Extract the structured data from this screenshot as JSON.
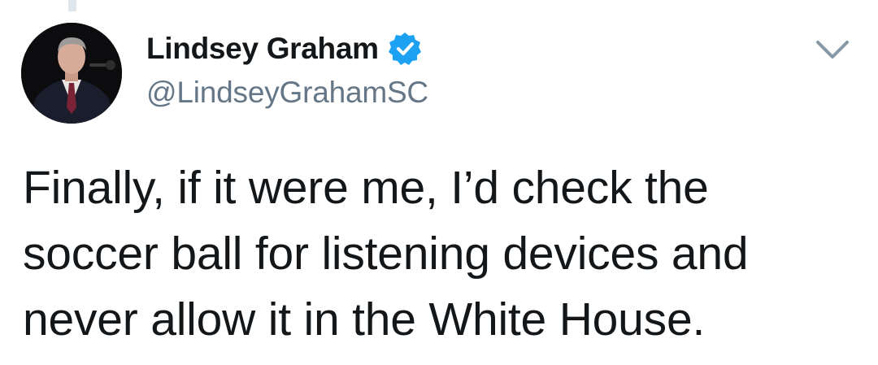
{
  "tweet": {
    "author": {
      "display_name": "Lindsey Graham",
      "handle": "@LindseyGrahamSC",
      "verified": true,
      "avatar_icon": "profile-photo"
    },
    "text_lines": [
      "Finally, if it were me, I’d check the",
      "soccer ball for listening devices and",
      "never allow it in the White House."
    ],
    "menu_icon": "chevron-down-icon"
  },
  "colors": {
    "text": "#14171a",
    "handle": "#657786",
    "verified_blue": "#1da1f2",
    "thread_line": "#dfe6ec",
    "background": "#ffffff"
  }
}
